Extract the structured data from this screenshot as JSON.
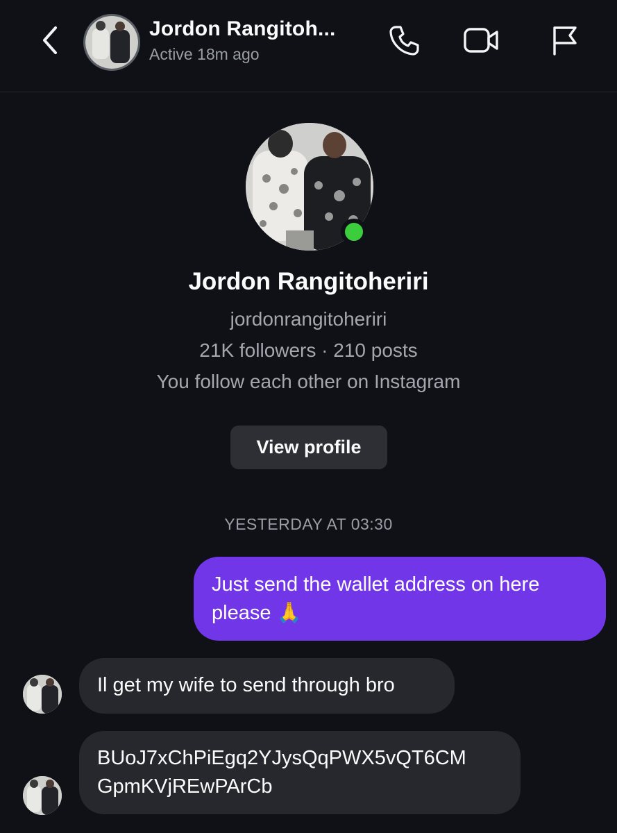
{
  "header": {
    "back_icon": "chevron-left-icon",
    "name": "Jordon Rangitoh...",
    "status": "Active 18m ago",
    "icons": [
      "phone-icon",
      "video-camera-icon",
      "flag-icon"
    ]
  },
  "profile": {
    "name": "Jordon Rangitoheriri",
    "handle": "jordonrangitoheriri",
    "stats": "21K followers · 210 posts",
    "mutual": "You follow each other on Instagram",
    "view_profile_label": "View profile",
    "online_color": "#3ccd3c"
  },
  "thread": {
    "timestamp": "YESTERDAY AT 03:30",
    "messages": [
      {
        "from": "me",
        "text": "Just send the wallet address on here please 🙏"
      },
      {
        "from": "them",
        "text": "Il get my wife to send through bro"
      },
      {
        "from": "them",
        "text": "BUoJ7xChPiEgq2YJysQqPWX5vQT6CM GpmKVjREwPArCb"
      }
    ]
  },
  "colors": {
    "background": "#0f1116",
    "outgoing_bubble": "#7136e8",
    "incoming_bubble": "#26282d",
    "button": "#2d2f35"
  }
}
